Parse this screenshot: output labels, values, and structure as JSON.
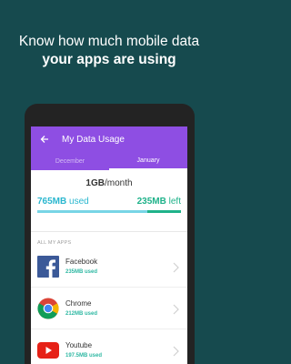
{
  "headline": {
    "line1": "Know how much mobile data",
    "line2": "your apps are using"
  },
  "screen": {
    "title": "My Data Usage",
    "tabs": [
      "December",
      "January"
    ],
    "active_tab": "January",
    "plan_amount": "1GB",
    "plan_period": "/month",
    "used_amount": "765MB",
    "used_label": " used",
    "left_amount": "235MB",
    "left_label": " left",
    "used_fraction": 0.765,
    "section_label": "ALL MY APPS",
    "apps": [
      {
        "name": "Facebook",
        "usage": "235MB used",
        "icon": "facebook-icon"
      },
      {
        "name": "Chrome",
        "usage": "212MB used",
        "icon": "chrome-icon"
      },
      {
        "name": "Youtube",
        "usage": "197.5MB used",
        "icon": "youtube-icon"
      }
    ]
  },
  "colors": {
    "background": "#164a4e",
    "appbar": "#8e4ee3",
    "used": "#2bb7cf",
    "left": "#1fb28a"
  }
}
